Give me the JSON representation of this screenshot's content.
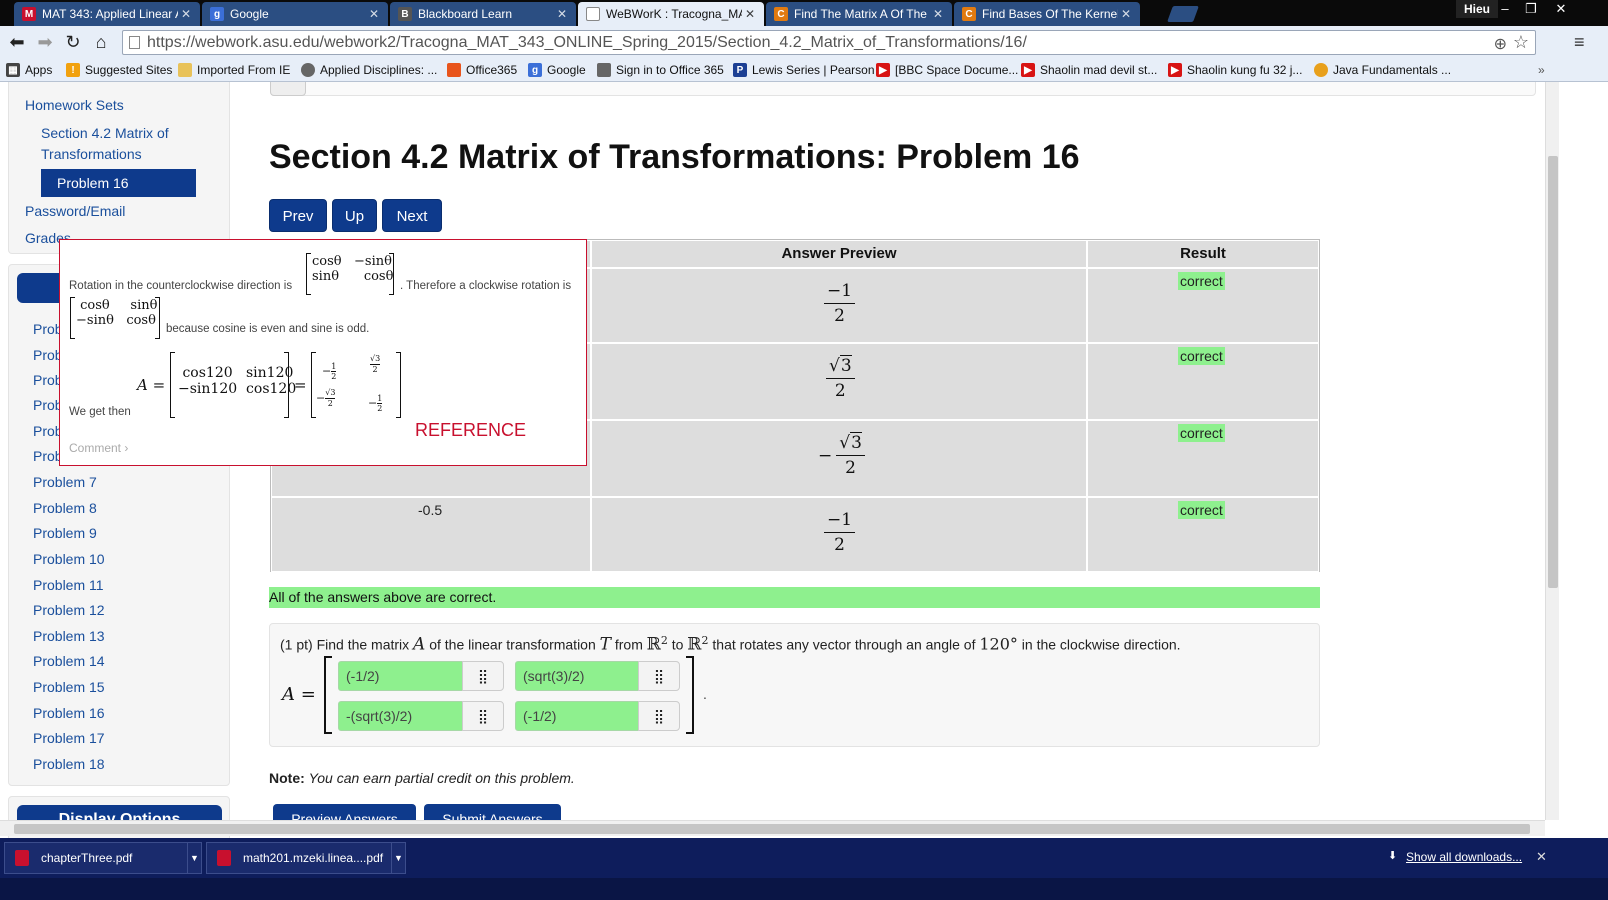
{
  "browser": {
    "tabs": [
      {
        "label": "MAT 343: Applied Linear A",
        "icon": "G-mail-like",
        "color": "#c8102e"
      },
      {
        "label": "Google",
        "icon": "g",
        "color": "#3b6fd8"
      },
      {
        "label": "Blackboard Learn",
        "icon": "Bb",
        "color": "#555"
      },
      {
        "label": "WeBWorK : Tracogna_MA",
        "icon": "doc",
        "color": "#fff"
      },
      {
        "label": "Find The Matrix A Of The",
        "icon": "C",
        "color": "#e07a10"
      },
      {
        "label": "Find Bases Of The Kernel",
        "icon": "C",
        "color": "#e07a10"
      }
    ],
    "profile": "Hieu",
    "url": "https://webwork.asu.edu/webwork2/Tracogna_MAT_343_ONLINE_Spring_2015/Section_4.2_Matrix_of_Transformations/16/",
    "bookmarks": [
      "Apps",
      "Suggested Sites",
      "Imported From IE",
      "Applied Disciplines: ...",
      "Office365",
      "Google",
      "Sign in to Office 365",
      "Lewis Series | Pearson",
      "[BBC Space Docume...",
      "Shaolin mad devil st...",
      "Shaolin kung fu 32 j...",
      "Java Fundamentals ..."
    ]
  },
  "sidebar": {
    "homework_sets": "Homework Sets",
    "section": "Section 4.2 Matrix of",
    "section_line2": "Transformations",
    "active_problem": "Problem 16",
    "password_email": "Password/Email",
    "grades": "Grades",
    "problem_partial": "Prob",
    "problems": [
      "Problem 7",
      "Problem 8",
      "Problem 9",
      "Problem 10",
      "Problem 11",
      "Problem 12",
      "Problem 13",
      "Problem 14",
      "Problem 15",
      "Problem 16",
      "Problem 17",
      "Problem 18"
    ],
    "display_options": "Display Options"
  },
  "main": {
    "title": "Section 4.2 Matrix of Transformations: Problem 16",
    "nav": {
      "prev": "Prev",
      "up": "Up",
      "next": "Next"
    },
    "results": {
      "col_preview": "Answer Preview",
      "col_result": "Result",
      "rows": [
        {
          "entered": "",
          "preview": "-1/2",
          "result": "correct"
        },
        {
          "entered": "",
          "preview": "sqrt(3)/2",
          "result": "correct"
        },
        {
          "entered": "",
          "preview": "-sqrt(3)/2",
          "result": "correct"
        },
        {
          "entered": "-0.5",
          "preview": "-1/2",
          "result": "correct"
        }
      ]
    },
    "all_correct": "All of the answers above are correct.",
    "problem": {
      "text_1": "(1 pt) Find the matrix",
      "var_A": "A",
      "text_2": "of the linear transformation",
      "var_T": "T",
      "text_3": "from",
      "space": "ℝ",
      "exp": "2",
      "text_4": "to",
      "text_5": "that rotates any vector through an angle of",
      "angle": "120°",
      "text_6": "in the clockwise direction.",
      "lhs": "A =",
      "answers": [
        "(-1/2)",
        "(sqrt(3)/2)",
        "-(sqrt(3)/2)",
        "(-1/2)"
      ],
      "period": "."
    },
    "note_label": "Note:",
    "note_text": "You can earn partial credit on this problem.",
    "buttons": {
      "preview": "Preview Answers",
      "submit": "Submit Answers"
    }
  },
  "popup": {
    "line1": "Rotation in the counterclockwise direction is",
    "line1b": ". Therefore a clockwise rotation is",
    "line2": "because cosine is even and sine is odd.",
    "we_get": "We get then",
    "ccw": [
      [
        "cosθ",
        "−sinθ"
      ],
      [
        "sinθ",
        "cosθ"
      ]
    ],
    "cw": [
      [
        "cosθ",
        "sinθ"
      ],
      [
        "−sinθ",
        "cosθ"
      ]
    ],
    "A_lhs": "A =",
    "A_mid": [
      [
        "cos120",
        "sin120"
      ],
      [
        "−sin120",
        "cos120"
      ]
    ],
    "eq": "=",
    "reference": "REFERENCE",
    "comment": "Comment"
  },
  "downloads": {
    "items": [
      "chapterThree.pdf",
      "math201.mzeki.linea....pdf"
    ],
    "show_all": "Show all downloads..."
  }
}
